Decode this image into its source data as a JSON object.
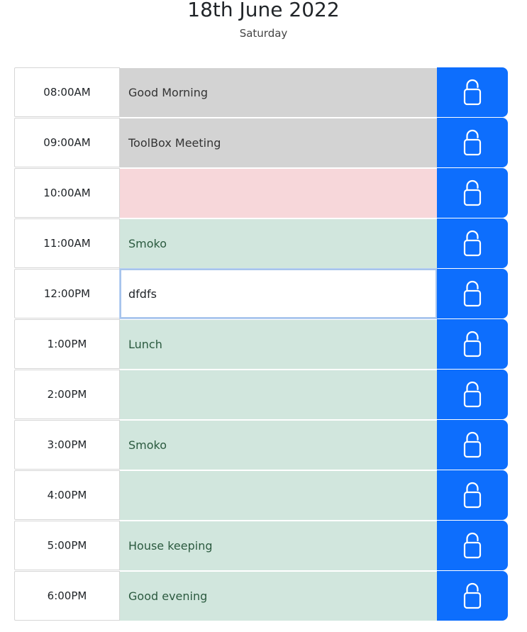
{
  "header": {
    "date": "18th June 2022",
    "weekday": "Saturday"
  },
  "icons": {
    "save": "lock-icon"
  },
  "colors": {
    "past": "#d3d3d3",
    "present": "#f7d7da",
    "future": "#d1e6dd",
    "save_button": "#0d6efd"
  },
  "rows": [
    {
      "hour": "08:00AM",
      "task": "Good Morning",
      "state": "past"
    },
    {
      "hour": "09:00AM",
      "task": "ToolBox Meeting",
      "state": "past"
    },
    {
      "hour": "10:00AM",
      "task": "",
      "state": "present"
    },
    {
      "hour": "11:00AM",
      "task": "Smoko",
      "state": "future"
    },
    {
      "hour": "12:00PM",
      "task": "dfdfs",
      "state": "editing"
    },
    {
      "hour": "1:00PM",
      "task": "Lunch",
      "state": "future"
    },
    {
      "hour": "2:00PM",
      "task": "",
      "state": "future"
    },
    {
      "hour": "3:00PM",
      "task": "Smoko",
      "state": "future"
    },
    {
      "hour": "4:00PM",
      "task": "",
      "state": "future"
    },
    {
      "hour": "5:00PM",
      "task": "House keeping",
      "state": "future"
    },
    {
      "hour": "6:00PM",
      "task": "Good evening",
      "state": "future"
    }
  ]
}
